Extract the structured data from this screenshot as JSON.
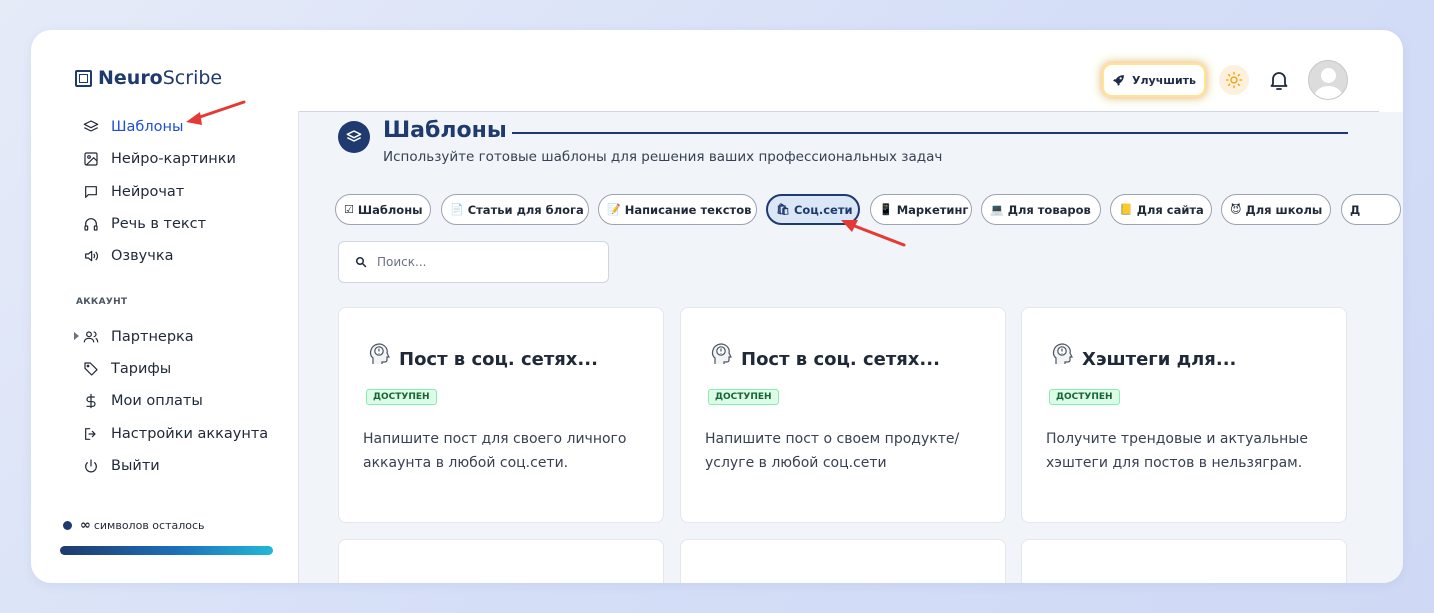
{
  "brand": {
    "bold": "Neuro",
    "light": "Scribe"
  },
  "header": {
    "upgrade_label": "Улучшить",
    "icons": [
      "rocket-icon",
      "sun-icon",
      "bell-icon",
      "avatar"
    ]
  },
  "sidebar": {
    "items": [
      {
        "label": "Шаблоны",
        "icon": "layers-icon",
        "active": true
      },
      {
        "label": "Нейро-картинки",
        "icon": "image-icon"
      },
      {
        "label": "Нейрочат",
        "icon": "chat-icon"
      },
      {
        "label": "Речь в текст",
        "icon": "headphones-icon"
      },
      {
        "label": "Озвучка",
        "icon": "speaker-icon"
      }
    ],
    "section_label": "АККАУНТ",
    "account_items": [
      {
        "label": "Партнерка",
        "icon": "users-icon"
      },
      {
        "label": "Тарифы",
        "icon": "tag-icon"
      },
      {
        "label": "Мои оплаты",
        "icon": "dollar-icon"
      },
      {
        "label": "Настройки аккаунта",
        "icon": "settings-icon"
      },
      {
        "label": "Выйти",
        "icon": "power-icon"
      }
    ],
    "chars_value": "∞",
    "chars_label": "символов осталось",
    "chars_fill_fraction": 1.0
  },
  "page": {
    "title": "Шаблоны",
    "subtitle": "Используйте готовые шаблоны для решения ваших профессиональных задач"
  },
  "categories": [
    {
      "emoji": "☑",
      "label": "Шаблоны"
    },
    {
      "emoji": "📄",
      "label": "Статьи для блога"
    },
    {
      "emoji": "📝",
      "label": "Написание текстов"
    },
    {
      "emoji": "🛍",
      "label": "Соц.сети",
      "active": true
    },
    {
      "emoji": "📱",
      "label": "Маркетинг"
    },
    {
      "emoji": "💻",
      "label": "Для товаров"
    },
    {
      "emoji": "📒",
      "label": "Для сайта"
    },
    {
      "emoji": "😈",
      "label": "Для школы"
    },
    {
      "emoji": "",
      "label": "Д"
    }
  ],
  "search": {
    "placeholder": "Поиск..."
  },
  "cards": [
    {
      "title": "Пост в соц. сетях...",
      "badge": "ДОСТУПЕН",
      "description": "Напишите пост для своего личного аккаунта в любой соц.сети."
    },
    {
      "title": "Пост в соц. сетях...",
      "badge": "ДОСТУПЕН",
      "description": "Напишите пост о своем продукте/услуге в любой соц.сети"
    },
    {
      "title": "Хэштеги для...",
      "badge": "ДОСТУПЕН",
      "description": "Получите трендовые и актуальные хэштеги для постов в нельзяграм."
    }
  ],
  "colors": {
    "accent": "#1f3a6e",
    "active_link": "#1d4ed8",
    "annotation_arrow": "#e53935",
    "badge_green": "#dcfce7"
  }
}
